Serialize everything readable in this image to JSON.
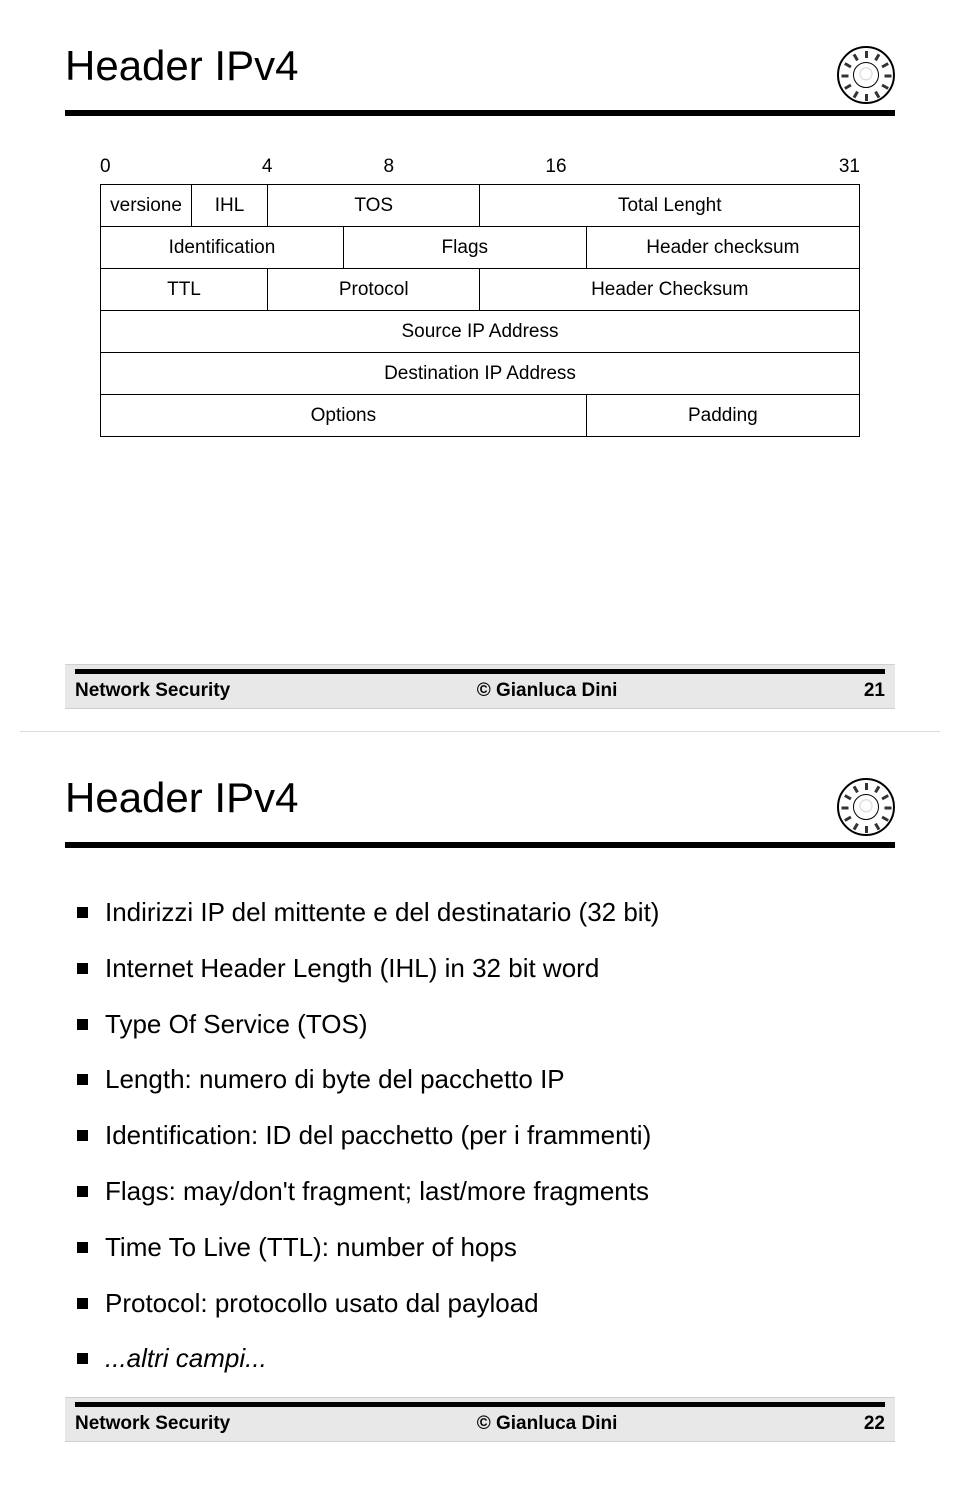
{
  "slide1": {
    "title": "Header IPv4",
    "bits": {
      "b0": "0",
      "b4": "4",
      "b8": "8",
      "b16": "16",
      "b31": "31"
    },
    "row1": {
      "versione": "versione",
      "ihl": "IHL",
      "tos": "TOS",
      "total_length": "Total Lenght"
    },
    "row2": {
      "identification": "Identification",
      "flags": "Flags",
      "header_checksum": "Header checksum"
    },
    "row3": {
      "ttl": "TTL",
      "protocol": "Protocol",
      "header_checksum2": "Header Checksum"
    },
    "row4": {
      "source_ip": "Source IP Address"
    },
    "row5": {
      "dest_ip": "Destination IP Address"
    },
    "row6": {
      "options": "Options",
      "padding": "Padding"
    },
    "footer": {
      "left": "Network Security",
      "center": "© Gianluca Dini",
      "right": "21"
    }
  },
  "slide2": {
    "title": "Header IPv4",
    "bullets": [
      "Indirizzi IP del mittente e del destinatario (32 bit)",
      "Internet Header Length (IHL) in 32 bit word",
      "Type Of Service (TOS)",
      "Length: numero di byte del pacchetto IP",
      "Identification: ID del pacchetto (per i frammenti)",
      "Flags: may/don't fragment; last/more fragments",
      "Time To Live (TTL): number of hops",
      "Protocol: protocollo usato dal payload"
    ],
    "last_bullet": "...altri campi...",
    "footer": {
      "left": "Network Security",
      "center": "© Gianluca Dini",
      "right": "22"
    }
  }
}
